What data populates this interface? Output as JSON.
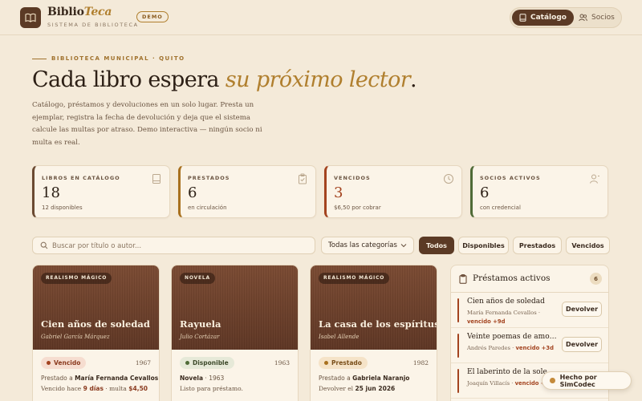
{
  "header": {
    "brand_main": "Biblio",
    "brand_accent": "Teca",
    "subtitle": "SISTEMA DE BIBLIOTECA",
    "badge": "DEMO",
    "nav": [
      {
        "label": "Catálogo",
        "icon": "book-icon",
        "active": true
      },
      {
        "label": "Socios",
        "icon": "users-icon",
        "active": false
      }
    ]
  },
  "hero": {
    "eyebrow": "BIBLIOTECA MUNICIPAL · QUITO",
    "title_start": "Cada libro espera ",
    "title_em": "su próximo lector",
    "title_end": ".",
    "description": "Catálogo, préstamos y devoluciones en un solo lugar. Presta un ejemplar, registra la fecha de devolución y deja que el sistema calcule las multas por atraso. Demo interactiva — ningún socio ni multa es real."
  },
  "stats": [
    {
      "label": "LIBROS EN CATÁLOGO",
      "value": "18",
      "sub": "12 disponibles",
      "icon": "book-icon",
      "color": "#6b4a32"
    },
    {
      "label": "PRESTADOS",
      "value": "6",
      "sub": "en circulación",
      "icon": "clipboard-icon",
      "color": "#a8701e"
    },
    {
      "label": "VENCIDOS",
      "value": "3",
      "sub": "$6,50 por cobrar",
      "icon": "clock-icon",
      "color": "#a3431f"
    },
    {
      "label": "SOCIOS ACTIVOS",
      "value": "6",
      "sub": "con credencial",
      "icon": "user-icon",
      "color": "#4f6b37"
    }
  ],
  "filters": {
    "search_placeholder": "Buscar por título o autor...",
    "category": "Todas las categorías",
    "chips": [
      {
        "label": "Todos",
        "active": true
      },
      {
        "label": "Disponibles",
        "active": false
      },
      {
        "label": "Prestados",
        "active": false
      },
      {
        "label": "Vencidos",
        "active": false
      }
    ]
  },
  "books": [
    {
      "tag": "REALISMO MÁGICO",
      "title": "Cien años de soledad",
      "author": "Gabriel García Márquez",
      "status": "Vencido",
      "year": "1967",
      "line1_prefix": "Prestado a ",
      "line1_bold": "María Fernanda Cevallos",
      "line2_a": "Vencido hace ",
      "line2_b": "9 días",
      "line2_c": " · multa ",
      "line2_d": "$4,50"
    },
    {
      "tag": "NOVELA",
      "title": "Rayuela",
      "author": "Julio Cortázar",
      "status": "Disponible",
      "year": "1963",
      "line1_prefix": "",
      "line1_bold": "Novela",
      "line1_suffix": " · 1963",
      "line2_a": "Listo para préstamo."
    },
    {
      "tag": "REALISMO MÁGICO",
      "title": "La casa de los espíritus",
      "author": "Isabel Allende",
      "status": "Prestado",
      "year": "1982",
      "line1_prefix": "Prestado a ",
      "line1_bold": "Gabriela Naranjo",
      "line2_a": "Devolver el ",
      "line2_b": "25 jun 2026"
    }
  ],
  "loans": {
    "title": "Préstamos activos",
    "count": "6",
    "button_label": "Devolver",
    "items": [
      {
        "title": "Cien años de soledad",
        "who": "María Fernanda Cevallos · ",
        "due": "vencido +9d"
      },
      {
        "title": "Veinte poemas de amor y una canción desesperada",
        "who": "Andrés Paredes · ",
        "due": "vencido +3d"
      },
      {
        "title": "El laberinto de la soledad",
        "who": "Joaquín Villacís · ",
        "due": "vencido +1d"
      }
    ]
  },
  "made_with": "Hecho por SimCodec"
}
